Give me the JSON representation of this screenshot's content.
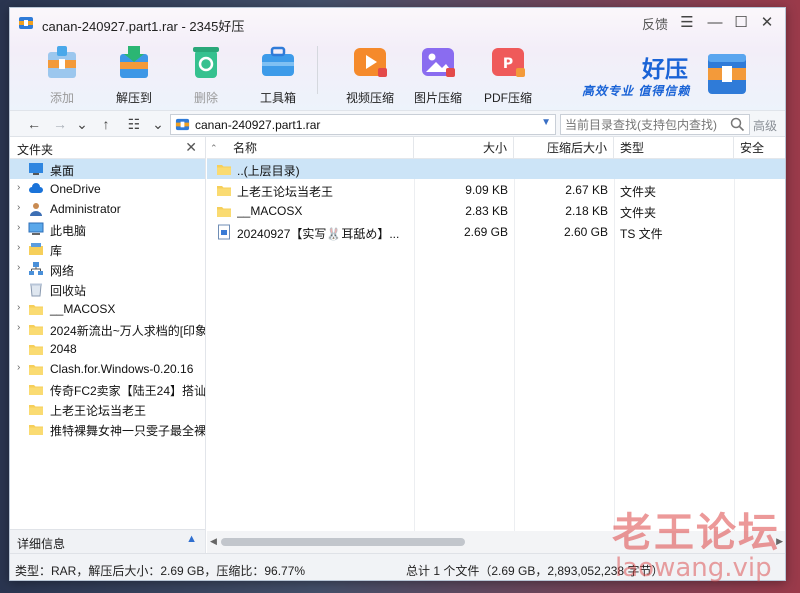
{
  "window": {
    "title": "canan-240927.part1.rar - 2345好压",
    "feedback": "反馈"
  },
  "ribbon": {
    "add": "添加",
    "extract_to": "解压到",
    "delete": "删除",
    "toolbox": "工具箱",
    "video_compress": "视频压缩",
    "image_compress": "图片压缩",
    "pdf_compress": "PDF压缩"
  },
  "brand": {
    "name": "好压",
    "slogan": "高效专业 值得信赖"
  },
  "address": {
    "path": "canan-240927.part1.rar",
    "search_placeholder": "当前目录查找(支持包内查找)",
    "advanced": "高级"
  },
  "left_pane": {
    "title": "文件夹",
    "footer": "详细信息",
    "tree": [
      {
        "label": "桌面",
        "icon": "desktop-icon",
        "expand": false,
        "selected": true
      },
      {
        "label": "OneDrive",
        "icon": "cloud-icon",
        "expand": true
      },
      {
        "label": "Administrator",
        "icon": "user-icon",
        "expand": true
      },
      {
        "label": "此电脑",
        "icon": "computer-icon",
        "expand": true
      },
      {
        "label": "库",
        "icon": "library-icon",
        "expand": true
      },
      {
        "label": "网络",
        "icon": "network-icon",
        "expand": true
      },
      {
        "label": "回收站",
        "icon": "recycle-bin-icon",
        "expand": false
      },
      {
        "label": "__MACOSX",
        "icon": "folder-icon",
        "expand": true
      },
      {
        "label": "2024新流出~万人求档的[印象",
        "icon": "folder-icon",
        "expand": true
      },
      {
        "label": "2048",
        "icon": "folder-icon",
        "expand": false
      },
      {
        "label": "Clash.for.Windows-0.20.16",
        "icon": "folder-icon",
        "expand": true
      },
      {
        "label": "传奇FC2卖家【陆王24】搭讪",
        "icon": "folder-icon",
        "expand": false
      },
      {
        "label": "上老王论坛当老王",
        "icon": "folder-icon",
        "expand": false
      },
      {
        "label": "推特裸舞女神一只雯子最全裸",
        "icon": "folder-icon",
        "expand": false
      }
    ]
  },
  "file_list": {
    "columns": [
      "名称",
      "大小",
      "压缩后大小",
      "类型",
      "安全"
    ],
    "rows": [
      {
        "name": "..(上层目录)",
        "size": "",
        "packed": "",
        "type": "",
        "icon": "folder-icon",
        "selected": true
      },
      {
        "name": "上老王论坛当老王",
        "size": "9.09 KB",
        "packed": "2.67 KB",
        "type": "文件夹",
        "icon": "folder-icon"
      },
      {
        "name": "__MACOSX",
        "size": "2.83 KB",
        "packed": "2.18 KB",
        "type": "文件夹",
        "icon": "folder-icon"
      },
      {
        "name": "20240927【实写🐰耳舐め】...",
        "size": "2.69 GB",
        "packed": "2.60 GB",
        "type": "TS 文件",
        "icon": "file-icon"
      }
    ]
  },
  "status": {
    "left": "类型：RAR，解压后大小：2.69 GB，压缩比：96.77%",
    "right": "总计 1 个文件（2.69 GB，2,893,052,238 字节）"
  },
  "watermark": {
    "line1": "老王论坛",
    "line2": "laowang.vip"
  },
  "colors": {
    "brand_blue": "#1a63d6",
    "selection": "#cce4f7",
    "folder_yellow": "#f6cf5a"
  }
}
